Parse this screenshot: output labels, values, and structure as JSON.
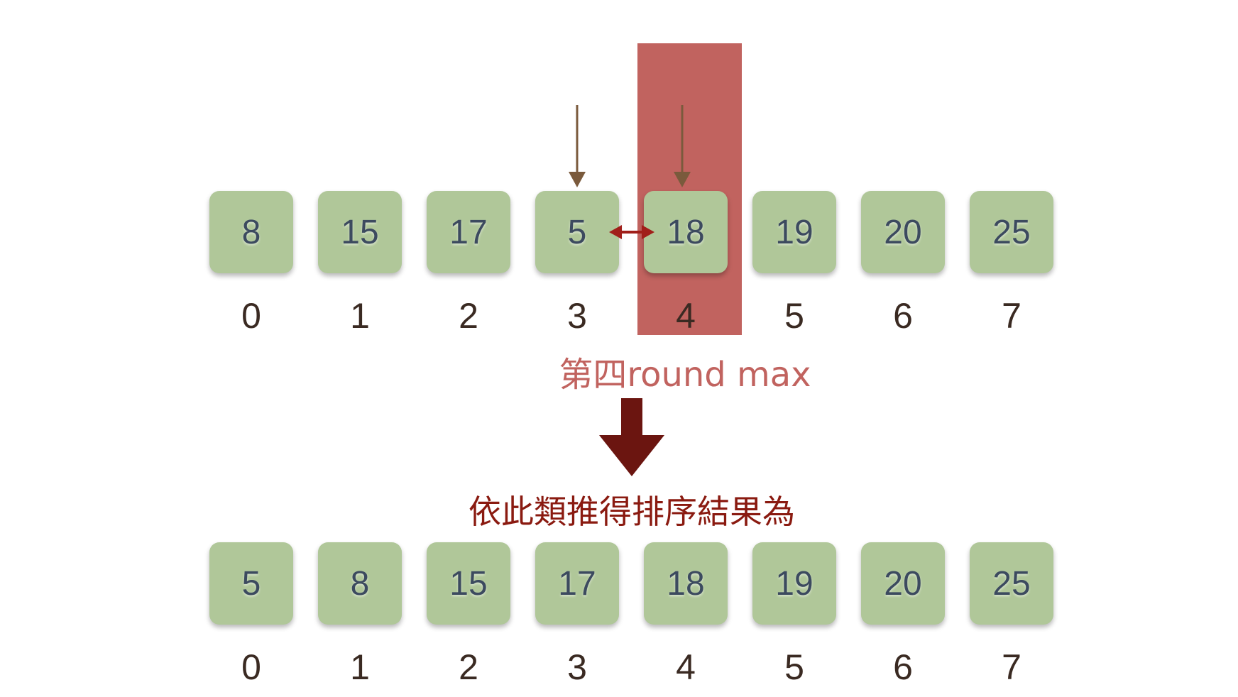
{
  "round_label": "第四round max",
  "result_label": "依此類推得排序結果為",
  "before": {
    "values": [
      "8",
      "15",
      "17",
      "5",
      "18",
      "19",
      "20",
      "25"
    ],
    "indices": [
      "0",
      "1",
      "2",
      "3",
      "4",
      "5",
      "6",
      "7"
    ]
  },
  "after": {
    "values": [
      "5",
      "8",
      "15",
      "17",
      "18",
      "19",
      "20",
      "25"
    ],
    "indices": [
      "0",
      "1",
      "2",
      "3",
      "4",
      "5",
      "6",
      "7"
    ]
  },
  "colors": {
    "box_fill": "#b0c799",
    "box_text": "#3c4a5f",
    "highlight": "#c1635f",
    "pointer_arrow": "#7a5a3c",
    "swap_arrow": "#a11f1a",
    "big_arrow": "#6b1510",
    "result_text": "#8a1a10"
  },
  "icons": {
    "pointer": "down-arrow-icon",
    "swap": "double-arrow-icon",
    "transition": "big-down-arrow-icon"
  }
}
